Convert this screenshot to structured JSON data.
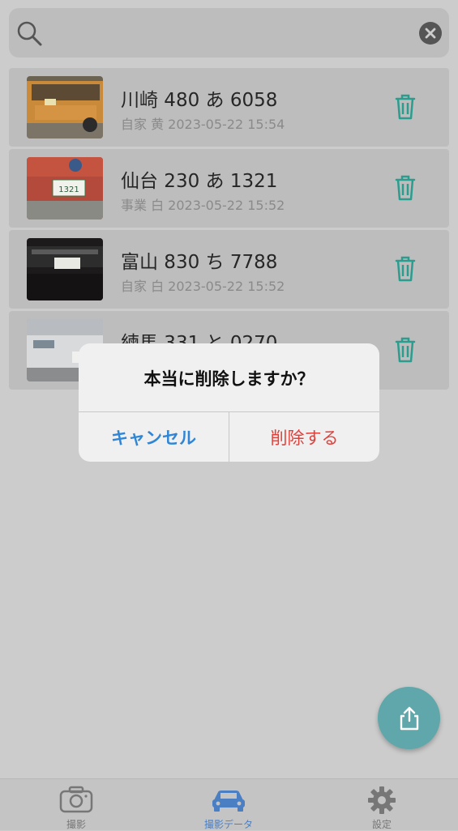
{
  "search": {
    "placeholder": ""
  },
  "records": [
    {
      "plate": "川崎 480 あ 6058",
      "meta": "自家 黄 2023-05-22 15:54"
    },
    {
      "plate": "仙台 230 あ 1321",
      "meta": "事業 白 2023-05-22 15:52"
    },
    {
      "plate": "富山 830 ち 7788",
      "meta": "自家 白 2023-05-22 15:52"
    },
    {
      "plate": "練馬 331 と 0270",
      "meta": ""
    }
  ],
  "dialog": {
    "title": "本当に削除しますか？",
    "cancel_label": "キャンセル",
    "delete_label": "削除する"
  },
  "tabs": [
    {
      "label": "撮影"
    },
    {
      "label": "撮影データ"
    },
    {
      "label": "設定"
    }
  ],
  "colors": {
    "accent": "#2a9d8f",
    "delete": "#e0403a",
    "cancel": "#2f86d6",
    "fab": "#5fa7aa"
  }
}
